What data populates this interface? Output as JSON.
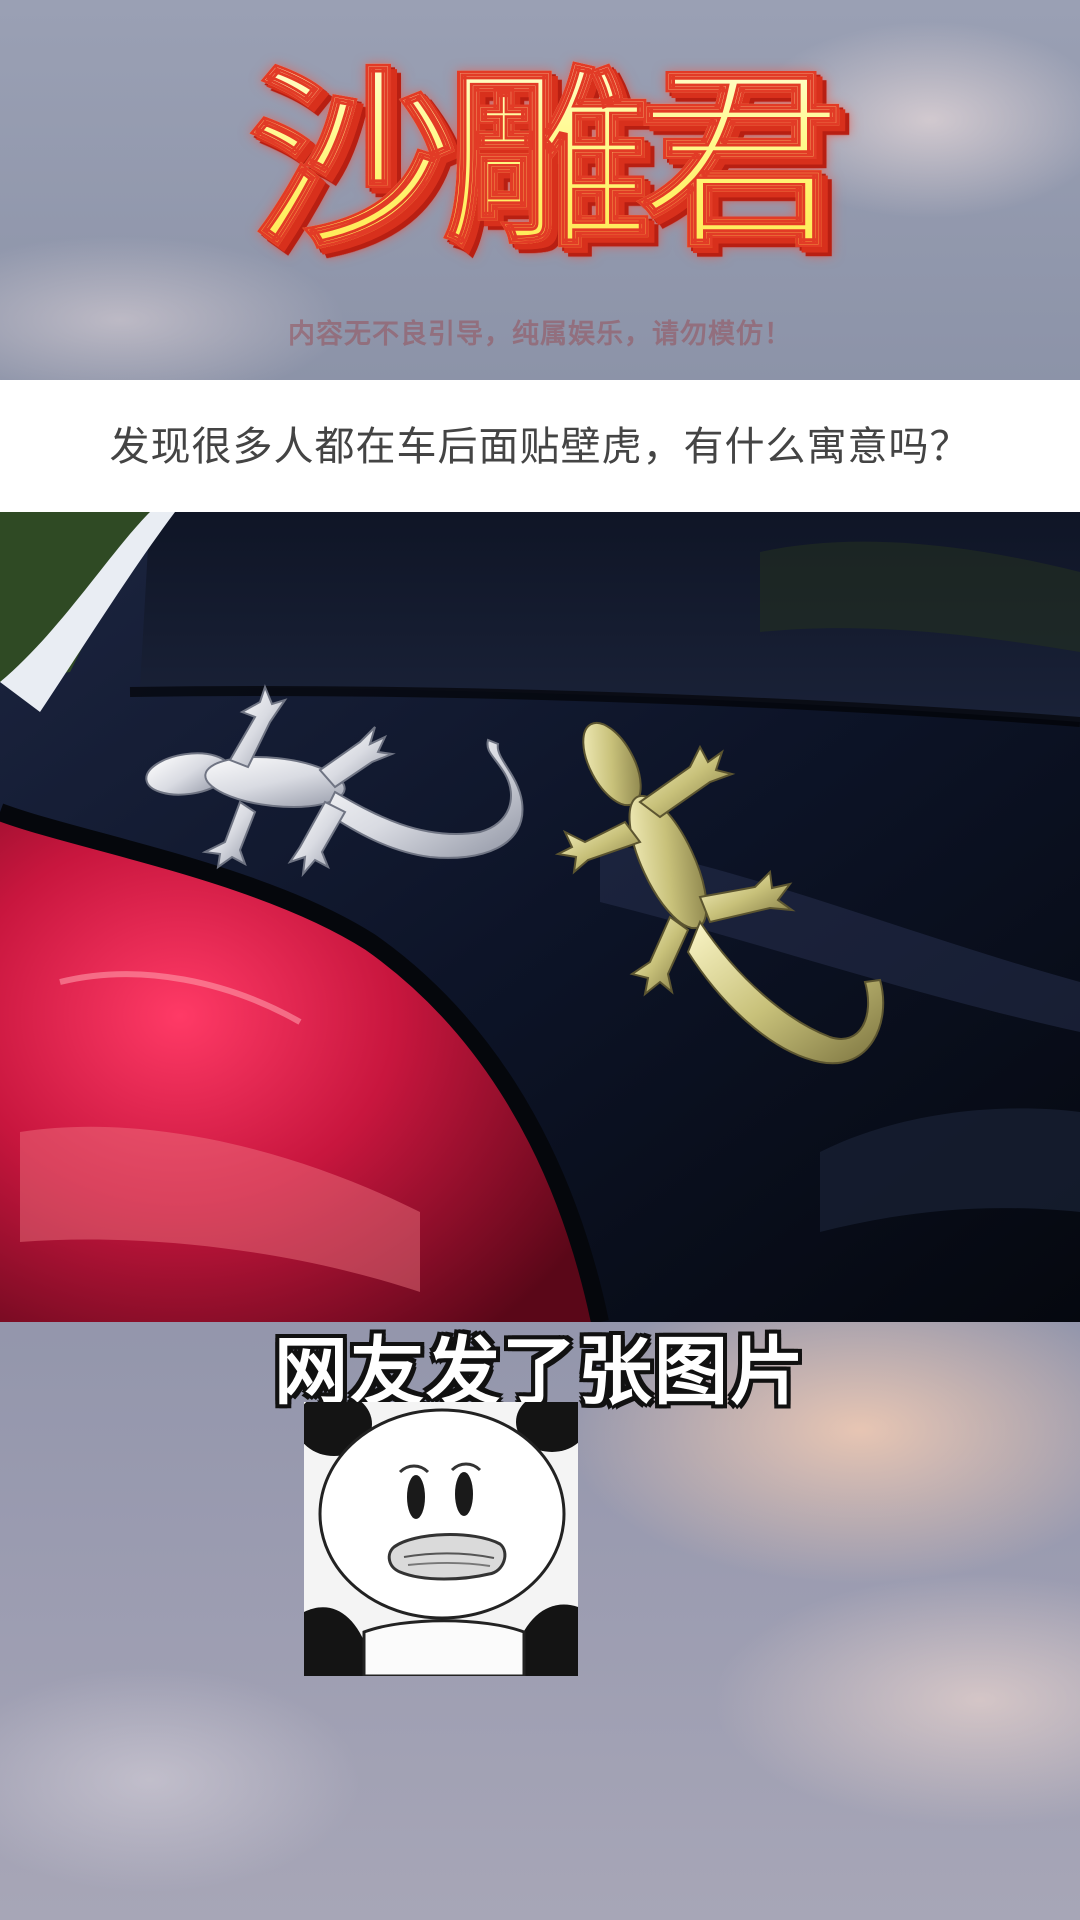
{
  "header": {
    "logo_text": "沙雕君",
    "disclaimer": "内容无不良引导，纯属娱乐，请勿模仿！"
  },
  "question": {
    "text": "发现很多人都在车后面贴壁虎，有什么寓意吗？"
  },
  "caption": {
    "text": "网友发了张图片"
  },
  "photo": {
    "subject": "gecko stickers on car rear"
  },
  "meme": {
    "subject": "panda meme face"
  },
  "colors": {
    "logo_fill": "#fff36a",
    "logo_outline": "#e23b26",
    "question_bar": "#ffffff",
    "question_text": "#444444",
    "caption_fill": "#ffffff",
    "caption_outline": "#111111"
  }
}
